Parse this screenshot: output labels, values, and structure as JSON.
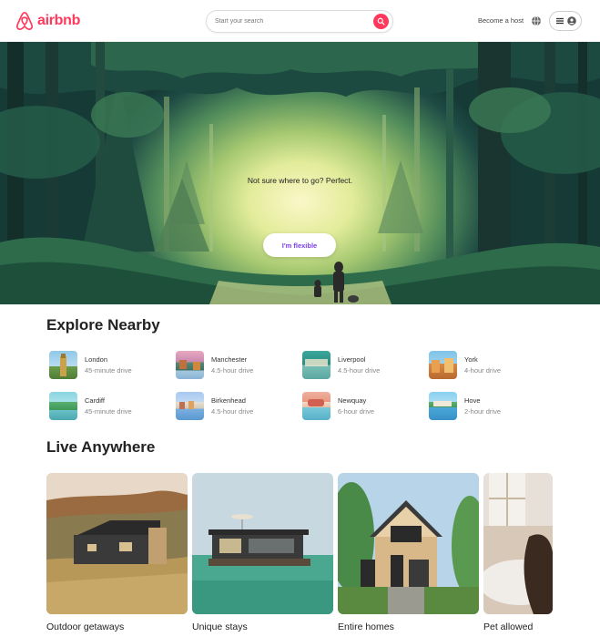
{
  "brand": {
    "name": "airbnb",
    "color": "#ff385c"
  },
  "search": {
    "placeholder": "Start your search",
    "icon": "search-icon"
  },
  "header": {
    "host_label": "Become a host",
    "globe_icon": "globe-icon",
    "menu_icon": "menu-icon",
    "avatar_icon": "user-avatar-icon"
  },
  "hero": {
    "tagline": "Not sure where to go? Perfect.",
    "button_label": "I'm flexible",
    "button_color": "#7b3fe4"
  },
  "explore": {
    "title": "Explore Nearby",
    "items": [
      {
        "name": "London",
        "drive": "45-minute drive"
      },
      {
        "name": "Manchester",
        "drive": "4.5-hour drive"
      },
      {
        "name": "Liverpool",
        "drive": "4.5-hour drive"
      },
      {
        "name": "York",
        "drive": "4-hour drive"
      },
      {
        "name": "Cardiff",
        "drive": "45-minute drive"
      },
      {
        "name": "Birkenhead",
        "drive": "4.5-hour drive"
      },
      {
        "name": "Newquay",
        "drive": "6-hour drive"
      },
      {
        "name": "Hove",
        "drive": "2-hour drive"
      }
    ]
  },
  "live": {
    "title": "Live Anywhere",
    "cards": [
      {
        "label": "Outdoor getaways"
      },
      {
        "label": "Unique stays"
      },
      {
        "label": "Entire homes"
      },
      {
        "label": "Pet allowed"
      }
    ]
  }
}
